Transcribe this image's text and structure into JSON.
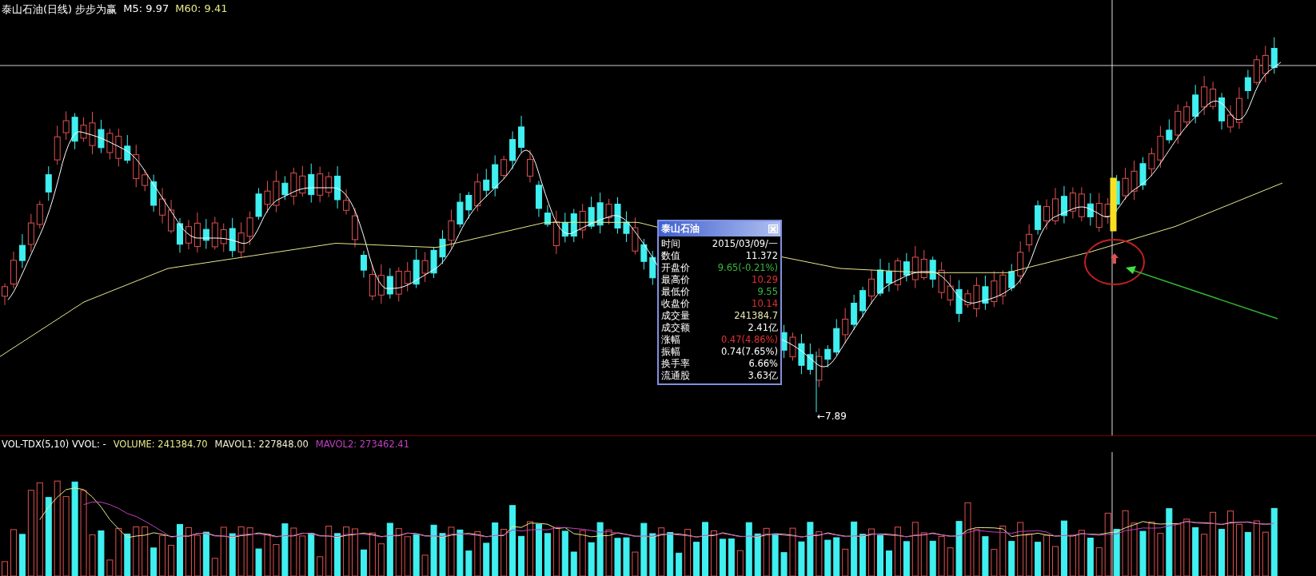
{
  "header": {
    "title": "泰山石油(日线) 步步为赢",
    "indicators": [
      {
        "text": "M5: 9.97",
        "color": "#ffffff"
      },
      {
        "text": "M60: 9.41",
        "color": "#e8e88c"
      }
    ]
  },
  "price_chart": {
    "low_label": "←7.89"
  },
  "info_panel": {
    "title": "泰山石油",
    "rows": [
      {
        "label": "时间",
        "value": "2015/03/09/一",
        "color": "#ffffff"
      },
      {
        "label": "数值",
        "value": "11.372",
        "color": "#ffffff"
      },
      {
        "label": "开盘价",
        "value": "9.65(-0.21%)",
        "color": "#3cb83c"
      },
      {
        "label": "最高价",
        "value": "10.29",
        "color": "#e03030"
      },
      {
        "label": "最低价",
        "value": "9.55",
        "color": "#3cb83c"
      },
      {
        "label": "收盘价",
        "value": "10.14",
        "color": "#e03030"
      },
      {
        "label": "成交量",
        "value": "241384.7",
        "color": "#e8e8b0"
      },
      {
        "label": "成交额",
        "value": "2.41亿",
        "color": "#ffffff"
      },
      {
        "label": "涨幅",
        "value": "0.47(4.86%)",
        "color": "#e03030"
      },
      {
        "label": "振幅",
        "value": "0.74(7.65%)",
        "color": "#ffffff"
      },
      {
        "label": "换手率",
        "value": "6.66%",
        "color": "#ffffff"
      },
      {
        "label": "流通股",
        "value": "3.63亿",
        "color": "#ffffff"
      }
    ]
  },
  "volume_header": {
    "items": [
      {
        "text": "VOL-TDX(5,10) VVOL: -",
        "color": "#ffffff"
      },
      {
        "text": "VOLUME: 241384.70",
        "color": "#e8e88c"
      },
      {
        "text": "MAVOL1: 227848.00",
        "color": "#f0f0d0"
      },
      {
        "text": "MAVOL2: 273462.41",
        "color": "#c040c0"
      }
    ]
  }
}
